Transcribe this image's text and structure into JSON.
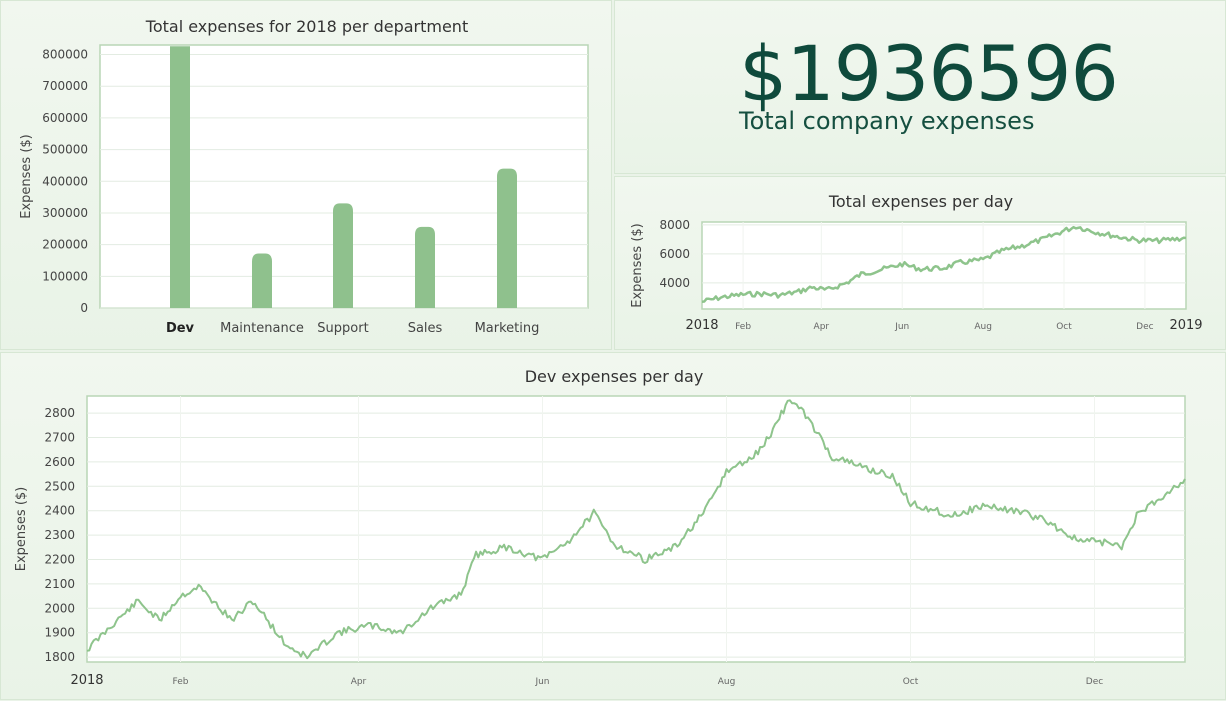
{
  "summary": {
    "total_value": "$1936596",
    "total_label": "Total company expenses"
  },
  "colors": {
    "accent": "#8fc18d",
    "line": "#8ec48c",
    "grid": "#e3ece2",
    "frame": "#b9d6b5",
    "big_text": "#0f4a3c"
  },
  "chart_data": [
    {
      "type": "bar",
      "title": "Total expenses for 2018 per department",
      "ylabel": "Expenses ($)",
      "xlabel": "",
      "categories": [
        "Dev",
        "Maintenance",
        "Support",
        "Sales",
        "Marketing"
      ],
      "values": [
        826000,
        172000,
        330000,
        256000,
        440000
      ],
      "ylim": [
        0,
        830000
      ],
      "yticks": [
        0,
        100000,
        200000,
        300000,
        400000,
        500000,
        600000,
        700000,
        800000
      ],
      "highlight": "Dev",
      "grid": true
    },
    {
      "type": "line",
      "title": "Total expenses per day",
      "ylabel": "Expenses ($)",
      "xlabel": "",
      "xlim": [
        "2018-01-01",
        "2019-01-01"
      ],
      "ylim": [
        2200,
        8200
      ],
      "yticks": [
        4000,
        6000,
        8000
      ],
      "xticks": [
        {
          "date": "2018-01-01",
          "label": "2018",
          "major": true
        },
        {
          "date": "2018-02-01",
          "label": "Feb",
          "major": false
        },
        {
          "date": "2018-04-01",
          "label": "Apr",
          "major": false
        },
        {
          "date": "2018-06-01",
          "label": "Jun",
          "major": false
        },
        {
          "date": "2018-08-01",
          "label": "Aug",
          "major": false
        },
        {
          "date": "2018-10-01",
          "label": "Oct",
          "major": false
        },
        {
          "date": "2018-12-01",
          "label": "Dec",
          "major": false
        },
        {
          "date": "2019-01-01",
          "label": "2019",
          "major": true
        }
      ],
      "points": [
        [
          "2018-01-01",
          2700
        ],
        [
          "2018-01-15",
          3000
        ],
        [
          "2018-02-01",
          3200
        ],
        [
          "2018-02-15",
          3250
        ],
        [
          "2018-03-01",
          3150
        ],
        [
          "2018-03-15",
          3400
        ],
        [
          "2018-03-25",
          3700
        ],
        [
          "2018-04-05",
          3500
        ],
        [
          "2018-04-20",
          4000
        ],
        [
          "2018-05-01",
          4600
        ],
        [
          "2018-05-20",
          5000
        ],
        [
          "2018-06-01",
          5300
        ],
        [
          "2018-06-15",
          4950
        ],
        [
          "2018-07-01",
          5000
        ],
        [
          "2018-07-15",
          5400
        ],
        [
          "2018-08-01",
          5600
        ],
        [
          "2018-08-15",
          6200
        ],
        [
          "2018-09-01",
          6600
        ],
        [
          "2018-09-15",
          7000
        ],
        [
          "2018-10-01",
          7600
        ],
        [
          "2018-10-10",
          7900
        ],
        [
          "2018-10-25",
          7500
        ],
        [
          "2018-11-10",
          7200
        ],
        [
          "2018-11-25",
          6950
        ],
        [
          "2018-12-10",
          6900
        ],
        [
          "2019-01-01",
          7100
        ]
      ],
      "grid": true
    },
    {
      "type": "line",
      "title": "Dev expenses per day",
      "ylabel": "Expenses ($)",
      "xlabel": "",
      "xlim": [
        "2018-01-01",
        "2018-12-31"
      ],
      "ylim": [
        1780,
        2870
      ],
      "yticks": [
        1800,
        1900,
        2000,
        2100,
        2200,
        2300,
        2400,
        2500,
        2600,
        2700,
        2800
      ],
      "xticks": [
        {
          "date": "2018-01-01",
          "label": "2018",
          "major": true
        },
        {
          "date": "2018-02-01",
          "label": "Feb",
          "major": false
        },
        {
          "date": "2018-04-01",
          "label": "Apr",
          "major": false
        },
        {
          "date": "2018-06-01",
          "label": "Jun",
          "major": false
        },
        {
          "date": "2018-08-01",
          "label": "Aug",
          "major": false
        },
        {
          "date": "2018-10-01",
          "label": "Oct",
          "major": false
        },
        {
          "date": "2018-12-01",
          "label": "Dec",
          "major": false
        }
      ],
      "points": [
        [
          "2018-01-01",
          1830
        ],
        [
          "2018-01-10",
          1940
        ],
        [
          "2018-01-18",
          2030
        ],
        [
          "2018-01-25",
          1950
        ],
        [
          "2018-02-01",
          2050
        ],
        [
          "2018-02-07",
          2090
        ],
        [
          "2018-02-18",
          1950
        ],
        [
          "2018-02-25",
          2030
        ],
        [
          "2018-03-08",
          1850
        ],
        [
          "2018-03-15",
          1800
        ],
        [
          "2018-03-25",
          1900
        ],
        [
          "2018-04-05",
          1930
        ],
        [
          "2018-04-15",
          1900
        ],
        [
          "2018-04-25",
          2000
        ],
        [
          "2018-05-05",
          2060
        ],
        [
          "2018-05-10",
          2220
        ],
        [
          "2018-05-20",
          2250
        ],
        [
          "2018-06-01",
          2200
        ],
        [
          "2018-06-10",
          2280
        ],
        [
          "2018-06-18",
          2390
        ],
        [
          "2018-06-25",
          2260
        ],
        [
          "2018-07-05",
          2200
        ],
        [
          "2018-07-15",
          2250
        ],
        [
          "2018-07-25",
          2400
        ],
        [
          "2018-08-01",
          2560
        ],
        [
          "2018-08-10",
          2620
        ],
        [
          "2018-08-15",
          2700
        ],
        [
          "2018-08-22",
          2860
        ],
        [
          "2018-08-28",
          2780
        ],
        [
          "2018-09-05",
          2620
        ],
        [
          "2018-09-15",
          2580
        ],
        [
          "2018-09-25",
          2540
        ],
        [
          "2018-10-01",
          2430
        ],
        [
          "2018-10-15",
          2380
        ],
        [
          "2018-10-25",
          2420
        ],
        [
          "2018-11-05",
          2400
        ],
        [
          "2018-11-15",
          2360
        ],
        [
          "2018-11-25",
          2280
        ],
        [
          "2018-12-05",
          2270
        ],
        [
          "2018-12-10",
          2250
        ],
        [
          "2018-12-15",
          2380
        ],
        [
          "2018-12-31",
          2530
        ]
      ],
      "grid": true
    }
  ]
}
